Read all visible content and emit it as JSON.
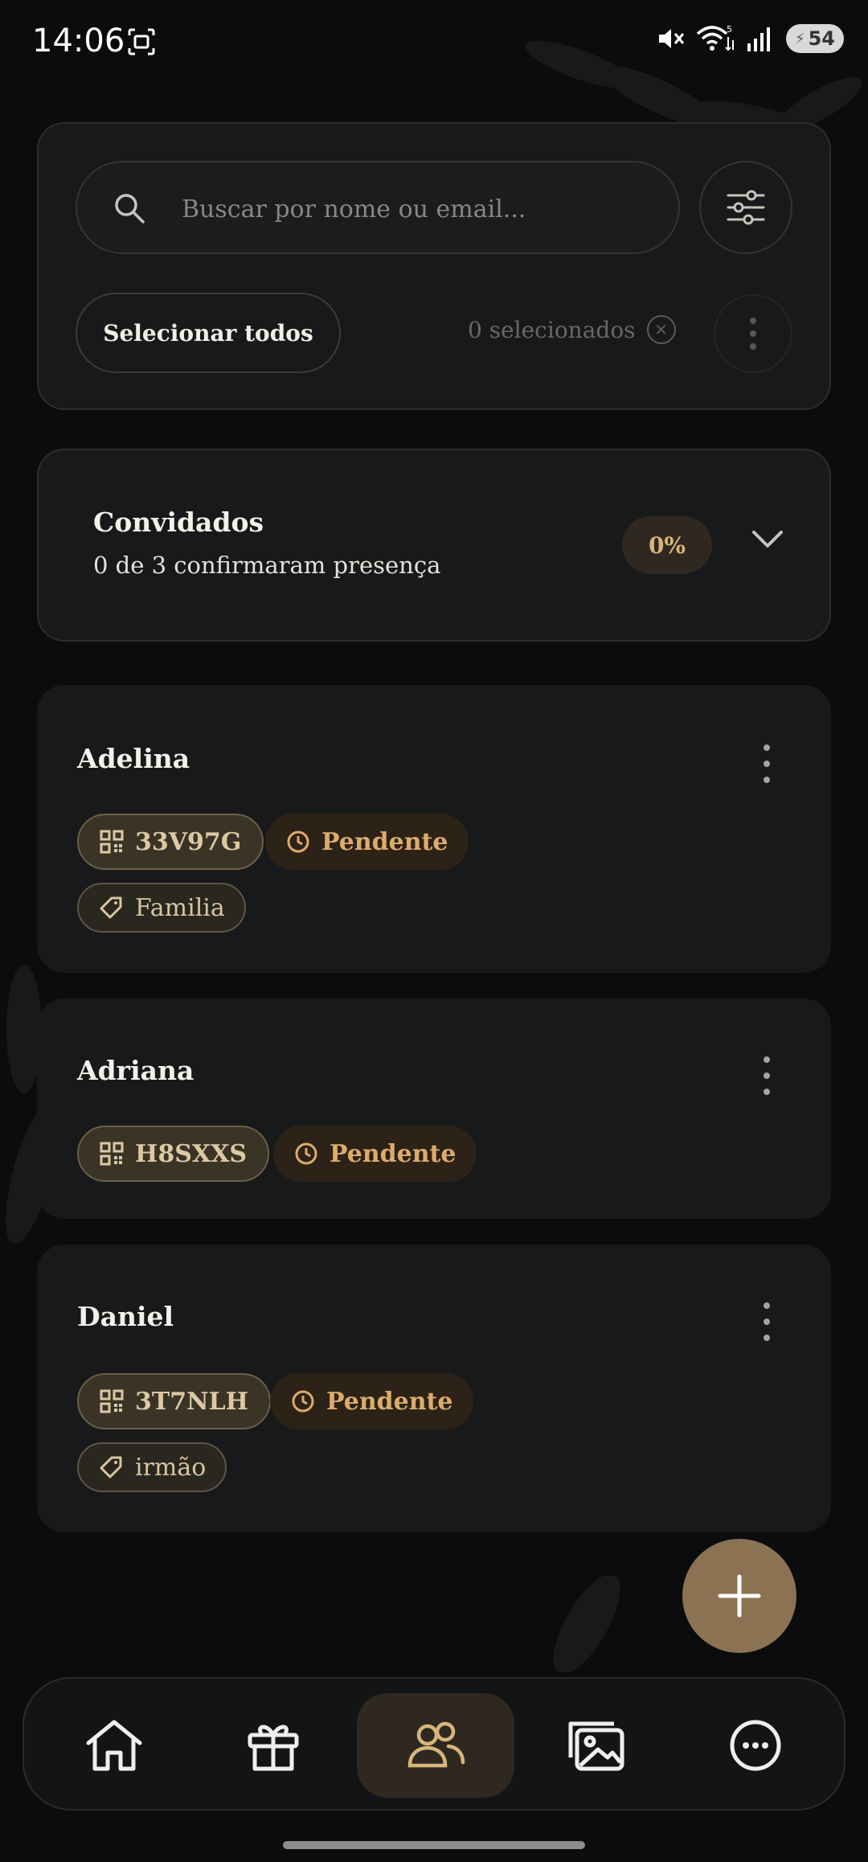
{
  "status_bar": {
    "time": "14:06",
    "battery": "54",
    "wifi_label": "5",
    "icons": [
      "screenshot-icon",
      "mute-icon",
      "wifi-icon",
      "signal-icon",
      "battery-icon"
    ]
  },
  "search": {
    "placeholder": "Buscar por nome ou email...",
    "value": ""
  },
  "selection": {
    "select_all_label": "Selecionar todos",
    "selected_count_label": "0 selecionados"
  },
  "summary": {
    "title": "Convidados",
    "subtitle": "0 de 3 confirmaram presença",
    "percent": "0%"
  },
  "guests": [
    {
      "name": "Adelina",
      "code": "33V97G",
      "status": "Pendente",
      "tag": "Familia"
    },
    {
      "name": "Adriana",
      "code": "H8SXXS",
      "status": "Pendente",
      "tag": ""
    },
    {
      "name": "Daniel",
      "code": "3T7NLH",
      "status": "Pendente",
      "tag": "irmão"
    }
  ],
  "nav": {
    "items": [
      {
        "icon": "home-icon",
        "active": false
      },
      {
        "icon": "gift-icon",
        "active": false
      },
      {
        "icon": "people-icon",
        "active": true
      },
      {
        "icon": "gallery-icon",
        "active": false
      },
      {
        "icon": "more-icon",
        "active": false
      }
    ]
  },
  "colors": {
    "background": "#0b0c0d",
    "card": "#18191b",
    "accent": "#8a7252",
    "accent_text": "#d9b57a",
    "status_pending": "#dcac6c"
  }
}
